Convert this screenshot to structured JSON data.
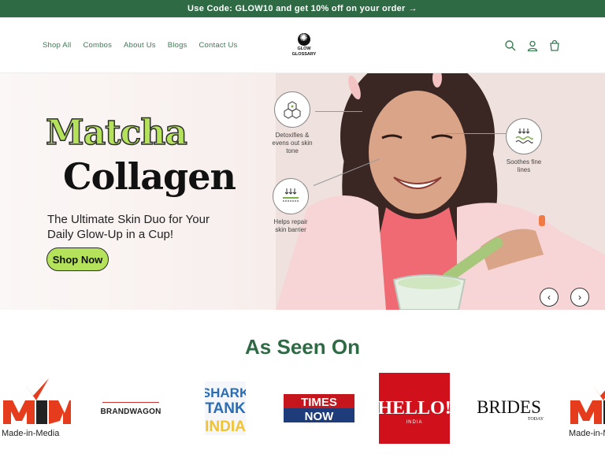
{
  "announcement": {
    "text": "Use Code: GLOW10 and get 10% off on your order",
    "arrow": "→"
  },
  "nav": {
    "items": [
      "Shop All",
      "Combos",
      "About Us",
      "Blogs",
      "Contact Us"
    ]
  },
  "logo": {
    "text_line1": "GLOW",
    "text_line2": "GLOSSARY"
  },
  "header_icons": [
    "search-icon",
    "account-icon",
    "cart-icon"
  ],
  "hero": {
    "title_line1": "Matcha",
    "title_line2": "Collagen",
    "subtitle": "The Ultimate Skin Duo for Your Daily Glow-Up in a Cup!",
    "cta": "Shop Now",
    "features": [
      {
        "label": "Detoxifies & evens out skin tone",
        "icon": "molecule-icon"
      },
      {
        "label": "Helps repair skin barrier",
        "icon": "skin-barrier-icon"
      },
      {
        "label": "Soothes fine lines",
        "icon": "fine-lines-icon"
      }
    ],
    "prev_label": "‹",
    "next_label": "›"
  },
  "seen_on": {
    "title": "As Seen On",
    "logos": [
      "Made-in-Media",
      "BRANDWAGON",
      "SHARK TANK INDIA",
      "TIMES NOW",
      "HELLO! INDIA",
      "BRIDES TODAY",
      "Made-in-Media"
    ]
  },
  "colors": {
    "brand_green": "#2e6b45",
    "accent_lime": "#b4e35b",
    "hello_red": "#d0101b",
    "timesnow_red": "#c4161c"
  }
}
